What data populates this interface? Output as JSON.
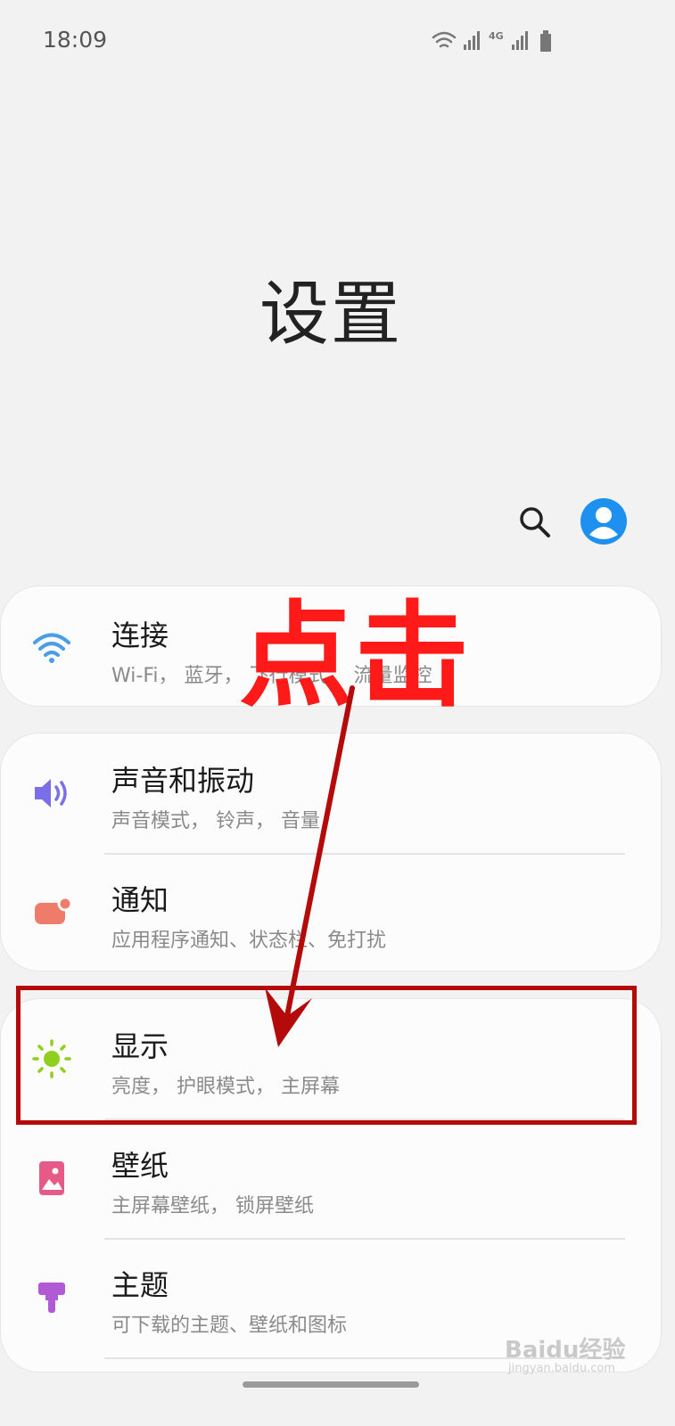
{
  "status_bar": {
    "time": "18:09",
    "network": "4G",
    "icons": [
      "wifi-icon",
      "signal-icon",
      "network-4g-icon",
      "signal-icon",
      "battery-icon"
    ]
  },
  "header": {
    "title": "设置",
    "search_icon": "search-icon",
    "account_icon": "account-icon"
  },
  "cards": [
    {
      "items": [
        {
          "title": "连接",
          "subtitle": "Wi-Fi， 蓝牙， 飞行模式， 流量监控",
          "icon": "wifi-icon",
          "icon_color": "#4a9de8"
        }
      ]
    },
    {
      "items": [
        {
          "title": "声音和振动",
          "subtitle": "声音模式， 铃声， 音量",
          "icon": "volume-icon",
          "icon_color": "#7b6fe8"
        },
        {
          "title": "通知",
          "subtitle": "应用程序通知、状态栏、免打扰",
          "icon": "notification-icon",
          "icon_color": "#ef7b6a"
        }
      ]
    },
    {
      "items": [
        {
          "title": "显示",
          "subtitle": "亮度， 护眼模式， 主屏幕",
          "icon": "brightness-icon",
          "icon_color": "#8fcf1e"
        },
        {
          "title": "壁纸",
          "subtitle": "主屏幕壁纸， 锁屏壁纸",
          "icon": "wallpaper-icon",
          "icon_color": "#e55a86"
        },
        {
          "title": "主题",
          "subtitle": "可下载的主题、壁纸和图标",
          "icon": "theme-icon",
          "icon_color": "#b05ad6"
        }
      ]
    }
  ],
  "annotation": {
    "text": "点击",
    "color": "#ff1a1a",
    "arrow_color": "#b50a0a"
  },
  "watermark": {
    "text": "Baidu经验",
    "sub": "jingyan.baidu.com"
  }
}
